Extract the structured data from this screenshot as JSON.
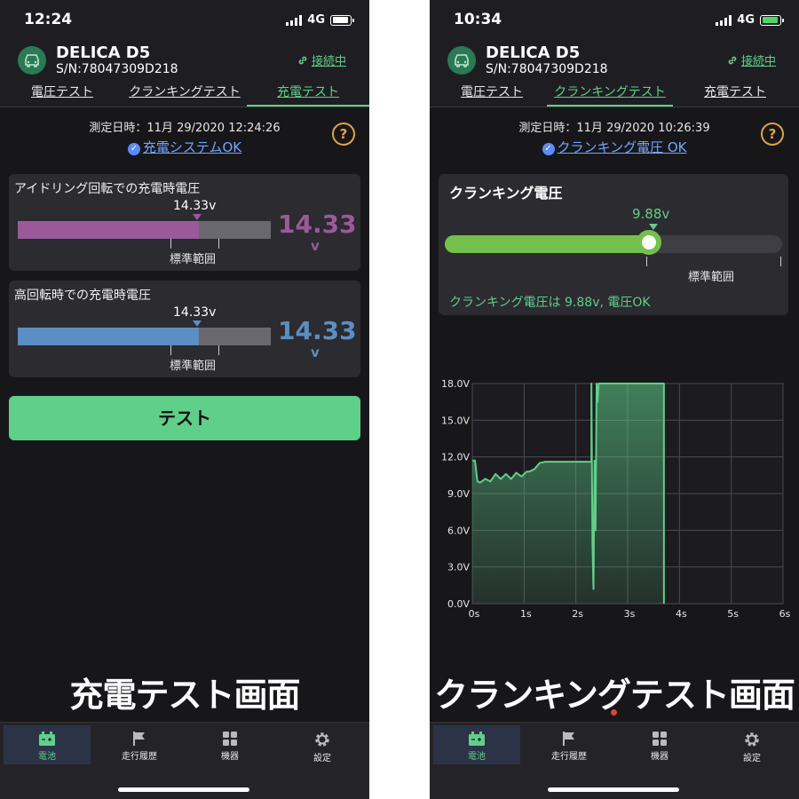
{
  "left": {
    "status": {
      "time": "12:24",
      "network": "4G"
    },
    "vehicle": {
      "name": "DELICA D5",
      "serial": "S/N:78047309D218",
      "connection": "接続中"
    },
    "tabs": [
      "電圧テスト",
      "クランキングテスト",
      "充電テスト"
    ],
    "active_tab": 2,
    "measured": "測定日時：11月 29/2020 12:24:26",
    "status_text": "充電システムOK",
    "help": "?",
    "idle": {
      "title": "アイドリング回転での充電時電圧",
      "marker": "14.33v",
      "range_label": "標準範囲",
      "value": "14.33",
      "unit": "v",
      "fill_percent": 71.5,
      "color": "#9a5a9a"
    },
    "high": {
      "title": "高回転時での充電時電圧",
      "marker": "14.33v",
      "range_label": "標準範囲",
      "value": "14.33",
      "unit": "v",
      "fill_percent": 71.5,
      "color": "#5b8ec2"
    },
    "test_button": "テスト",
    "caption": "充電テスト画面"
  },
  "right": {
    "status": {
      "time": "10:34",
      "network": "4G"
    },
    "vehicle": {
      "name": "DELICA D5",
      "serial": "S/N:78047309D218",
      "connection": "接続中"
    },
    "tabs": [
      "電圧テスト",
      "クランキングテスト",
      "充電テスト"
    ],
    "active_tab": 1,
    "measured": "測定日時：11月 29/2020 10:26:39",
    "status_text": "クランキング電圧 OK",
    "help": "?",
    "cranking": {
      "title": "クランキング電圧",
      "value": "9.88v",
      "range_label": "標準範囲",
      "message": "クランキング電圧は 9.88v, 電圧OK",
      "fill_percent": 60.5
    },
    "caption": "クランキングテスト画面"
  },
  "tabbar": [
    {
      "label": "電池",
      "icon": "battery-icon"
    },
    {
      "label": "走行履歴",
      "icon": "flag-icon"
    },
    {
      "label": "機器",
      "icon": "grid-icon"
    },
    {
      "label": "設定",
      "icon": "gear-icon"
    }
  ],
  "chart_data": {
    "type": "line",
    "title": "",
    "xlabel": "",
    "ylabel": "",
    "x_ticks": [
      "0s",
      "1s",
      "2s",
      "3s",
      "4s",
      "5s",
      "6s"
    ],
    "y_ticks": [
      "0.0V",
      "3.0V",
      "6.0V",
      "9.0V",
      "12.0V",
      "15.0V",
      "18.0V"
    ],
    "xlim": [
      0,
      6
    ],
    "ylim": [
      0,
      18
    ],
    "grid": true,
    "series": [
      {
        "color": "#5fd08a",
        "x": [
          0,
          0.05,
          0.1,
          0.15,
          0.25,
          0.35,
          0.45,
          0.55,
          0.65,
          0.75,
          0.85,
          0.95,
          1.05,
          1.1,
          1.2,
          1.3,
          1.4,
          1.5,
          1.6,
          2.0,
          2.2,
          2.3,
          2.3,
          2.32,
          2.34,
          2.36,
          2.38,
          2.4,
          2.42,
          2.44,
          2.48,
          2.6,
          3.0,
          3.5,
          3.7,
          3.7
        ],
        "y": [
          11.7,
          11.7,
          10.0,
          9.9,
          10.2,
          10.0,
          10.6,
          10.2,
          10.6,
          10.2,
          10.7,
          10.4,
          10.8,
          10.8,
          11.0,
          11.5,
          11.6,
          11.6,
          11.6,
          11.6,
          11.6,
          11.6,
          18.0,
          5.0,
          1.2,
          11.7,
          6.0,
          18.0,
          16.5,
          18.0,
          18.0,
          18.0,
          18.0,
          18.0,
          18.0,
          0
        ]
      }
    ]
  }
}
